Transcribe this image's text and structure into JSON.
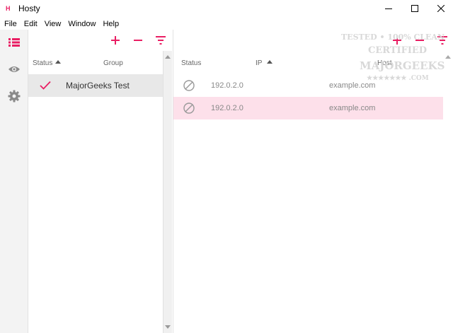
{
  "window": {
    "title": "Hosty",
    "app_icon_glyph": "H",
    "accent_color": "#e91e63",
    "selected_row_color": "#fde0ea"
  },
  "menu": {
    "items": [
      "File",
      "Edit",
      "View",
      "Window",
      "Help"
    ]
  },
  "sidebar": {
    "items": [
      {
        "name": "list-icon",
        "active": true
      },
      {
        "name": "eye-icon",
        "active": false
      },
      {
        "name": "gear-icon",
        "active": false
      }
    ]
  },
  "groups_pane": {
    "toolbar": {
      "add": "+",
      "remove": "−",
      "filter": "filter-icon"
    },
    "columns": {
      "status": "Status",
      "group": "Group"
    },
    "sorted_column": "Status",
    "rows": [
      {
        "status": "enabled",
        "name": "MajorGeeks Test",
        "selected": true
      }
    ]
  },
  "hosts_pane": {
    "columns": {
      "status": "Status",
      "ip": "IP",
      "host": "Host"
    },
    "sorted_column": "IP",
    "rows": [
      {
        "status": "disabled",
        "ip": "192.0.2.0",
        "host": "example.com",
        "selected": false
      },
      {
        "status": "disabled",
        "ip": "192.0.2.0",
        "host": "example.com",
        "selected": true
      }
    ]
  },
  "watermark": {
    "line1": "TESTED • 100% CLEAN",
    "line2": "CERTIFIED",
    "line3": "MAJORGEEKS",
    "line4": "★★★★★★★ .COM"
  }
}
